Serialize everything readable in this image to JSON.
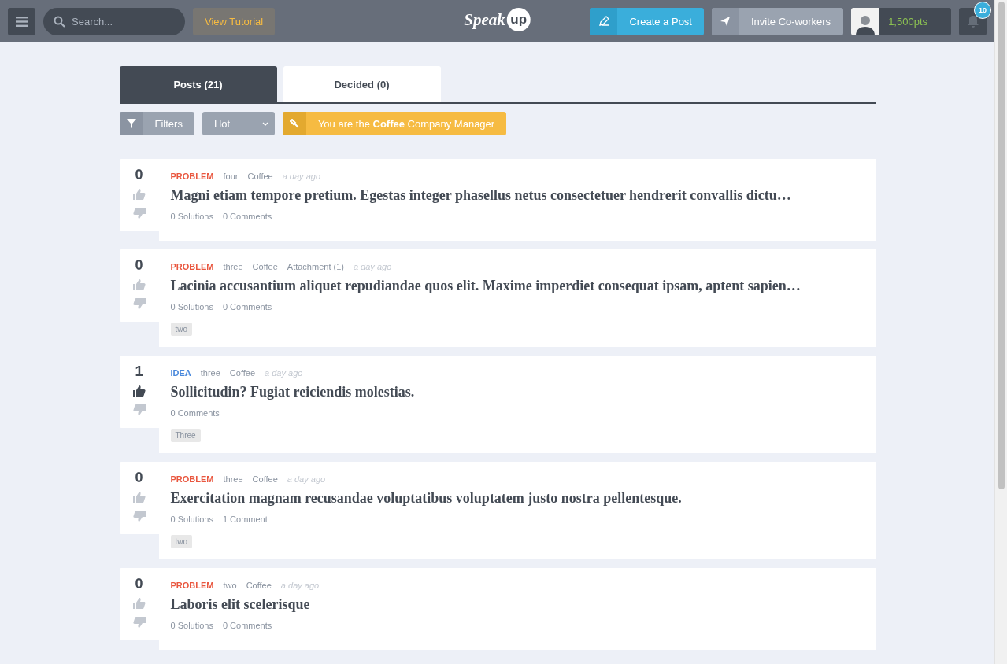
{
  "header": {
    "search": {
      "placeholder": "Search..."
    },
    "tutorial_button": "View Tutorial",
    "logo": {
      "word": "Speak",
      "bubble": "up"
    },
    "create_button": "Create a Post",
    "invite_button": "Invite Co-workers",
    "points": "1,500pts",
    "notifications": "10"
  },
  "tabs": [
    {
      "label": "Posts (21)",
      "selected": true
    },
    {
      "label": "Decided (0)",
      "selected": false
    }
  ],
  "toolbar": {
    "filters_button": "Filters",
    "sort": {
      "value": "Hot"
    },
    "role_banner": "You are the **Coffee** Company Manager"
  },
  "posts": [
    {
      "votes": "0",
      "upvoted": false,
      "kind": "problem",
      "type_label": "PROBLEM",
      "meta": [
        "four",
        "Coffee"
      ],
      "time": "a day ago",
      "title": "Magni etiam tempore pretium. Egestas integer phasellus netus consectetuer hendrerit convallis dictu…",
      "stats": [
        "0 Solutions",
        "0 Comments"
      ]
    },
    {
      "votes": "0",
      "upvoted": false,
      "kind": "problem",
      "type_label": "PROBLEM",
      "meta": [
        "three",
        "Coffee",
        "Attachment (1)"
      ],
      "time": "a day ago",
      "title": "Lacinia accusantium aliquet repudiandae quos elit. Maxime imperdiet consequat ipsam, aptent sapien…",
      "stats": [
        "0 Solutions",
        "0 Comments"
      ],
      "tags": [
        "two"
      ]
    },
    {
      "votes": "1",
      "upvoted": true,
      "kind": "idea",
      "type_label": "IDEA",
      "meta": [
        "three",
        "Coffee"
      ],
      "time": "a day ago",
      "title": "Sollicitudin? Fugiat reiciendis molestias.",
      "stats": [
        "0 Comments"
      ],
      "tags": [
        "Three"
      ]
    },
    {
      "votes": "0",
      "upvoted": false,
      "kind": "problem",
      "type_label": "PROBLEM",
      "meta": [
        "three",
        "Coffee"
      ],
      "time": "a day ago",
      "title": "Exercitation magnam recusandae voluptatibus voluptatem justo nostra pellentesque.",
      "stats": [
        "0 Solutions",
        "1 Comment"
      ],
      "tags": [
        "two"
      ]
    },
    {
      "votes": "0",
      "upvoted": false,
      "kind": "problem",
      "type_label": "PROBLEM",
      "meta": [
        "two",
        "Coffee"
      ],
      "time": "a day ago",
      "title": "Laboris elit scelerisque",
      "stats": [
        "0 Solutions",
        "0 Comments"
      ]
    }
  ]
}
